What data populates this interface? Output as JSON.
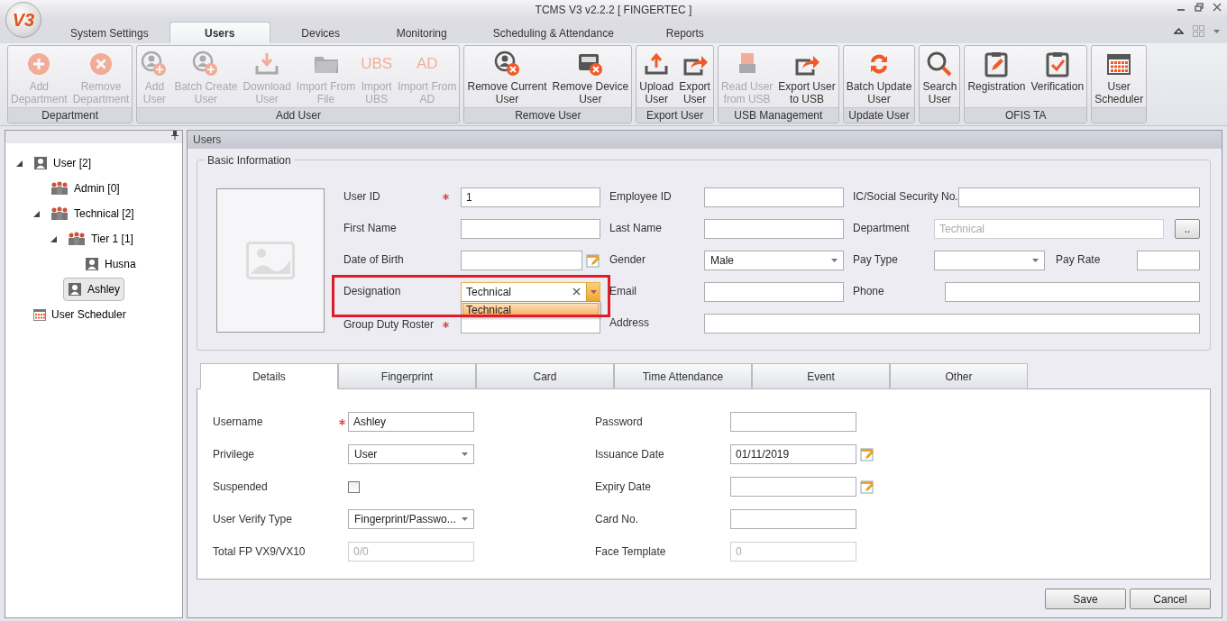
{
  "window": {
    "title": "TCMS V3 v2.2.2 [ FINGERTEC ]",
    "logo": "V3"
  },
  "menu_tabs": [
    {
      "label": "System Settings",
      "selected": false
    },
    {
      "label": "Users",
      "selected": true
    },
    {
      "label": "Devices",
      "selected": false
    },
    {
      "label": "Monitoring",
      "selected": false
    },
    {
      "label": "Scheduling & Attendance",
      "selected": false
    },
    {
      "label": "Reports",
      "selected": false
    }
  ],
  "ribbon": [
    {
      "name": "Department",
      "buttons": [
        {
          "label": "Add\nDepartment",
          "kind": "plus-circle",
          "disabled": true
        },
        {
          "label": "Remove\nDepartment",
          "kind": "x-circle",
          "disabled": true
        }
      ]
    },
    {
      "name": "Add User",
      "buttons": [
        {
          "label": "Add\nUser",
          "kind": "user-plus",
          "disabled": true
        },
        {
          "label": "Batch Create\nUser",
          "kind": "user-plus",
          "disabled": true
        },
        {
          "label": "Download\nUser",
          "kind": "download",
          "disabled": true
        },
        {
          "label": "Import From\nFile",
          "kind": "folder",
          "disabled": true
        },
        {
          "label": "Import\nUBS",
          "kind": "text",
          "icon_text": "UBS",
          "disabled": true
        },
        {
          "label": "Import From\nAD",
          "kind": "text",
          "icon_text": "AD",
          "disabled": true
        }
      ]
    },
    {
      "name": "Remove User",
      "buttons": [
        {
          "label": "Remove Current\nUser",
          "kind": "user-x",
          "disabled": false
        },
        {
          "label": "Remove Device\nUser",
          "kind": "device-x",
          "disabled": false
        }
      ]
    },
    {
      "name": "Export User",
      "buttons": [
        {
          "label": "Upload\nUser",
          "kind": "upload",
          "disabled": false
        },
        {
          "label": "Export\nUser",
          "kind": "export",
          "disabled": false
        }
      ]
    },
    {
      "name": "USB Management",
      "buttons": [
        {
          "label": "Read User\nfrom USB",
          "kind": "usb",
          "disabled": true
        },
        {
          "label": "Export User\nto USB",
          "kind": "export",
          "disabled": false
        }
      ]
    },
    {
      "name": "Update User",
      "buttons": [
        {
          "label": "Batch Update\nUser",
          "kind": "sync",
          "disabled": false
        }
      ]
    },
    {
      "buttons": [
        {
          "label": "Search\nUser",
          "kind": "search",
          "disabled": false
        }
      ]
    },
    {
      "name": "OFIS TA",
      "buttons": [
        {
          "label": "Registration",
          "kind": "clipboard-edit",
          "disabled": false
        },
        {
          "label": "Verification",
          "kind": "clipboard-check",
          "disabled": false
        }
      ]
    },
    {
      "buttons": [
        {
          "label": "User\nScheduler",
          "kind": "calendar",
          "disabled": false
        }
      ]
    }
  ],
  "tree": [
    {
      "label": "User [2]",
      "kind": "user",
      "selected": false,
      "expanded": true,
      "children": [
        {
          "label": "Admin [0]",
          "kind": "group",
          "selected": false
        },
        {
          "label": "Technical [2]",
          "kind": "group",
          "selected": false,
          "expanded": true,
          "children": [
            {
              "label": "Tier 1 [1]",
              "kind": "group",
              "selected": false,
              "expanded": true,
              "children": [
                {
                  "label": "Husna",
                  "kind": "user",
                  "selected": false
                }
              ]
            },
            {
              "label": "Ashley",
              "kind": "user",
              "selected": true
            }
          ]
        }
      ]
    },
    {
      "label": "User Scheduler",
      "kind": "scheduler",
      "selected": false
    }
  ],
  "panel_title": "Users",
  "basic_info": {
    "title": "Basic Information",
    "user_id": {
      "label": "User ID",
      "value": "1",
      "required": true
    },
    "employee_id": {
      "label": "Employee ID"
    },
    "ic_no": {
      "label": "IC/Social Security No."
    },
    "first_name": {
      "label": "First Name"
    },
    "last_name": {
      "label": "Last Name"
    },
    "department": {
      "label": "Department",
      "value": "Technical",
      "disabled": true,
      "browse": ".."
    },
    "date_of_birth": {
      "label": "Date of Birth"
    },
    "gender": {
      "label": "Gender",
      "value": "Male"
    },
    "pay_type": {
      "label": "Pay Type"
    },
    "pay_rate": {
      "label": "Pay Rate"
    },
    "designation": {
      "label": "Designation",
      "value": "Technical",
      "open": true,
      "options": [
        {
          "label": "Technical",
          "selected": true
        }
      ]
    },
    "email": {
      "label": "Email"
    },
    "phone": {
      "label": "Phone"
    },
    "group_duty_roster": {
      "label": "Group Duty Roster",
      "required": true
    },
    "address": {
      "label": "Address"
    }
  },
  "detail_tabs": [
    {
      "label": "Details",
      "selected": true
    },
    {
      "label": "Fingerprint",
      "selected": false
    },
    {
      "label": "Card",
      "selected": false
    },
    {
      "label": "Time Attendance",
      "selected": false
    },
    {
      "label": "Event",
      "selected": false
    },
    {
      "label": "Other",
      "selected": false
    }
  ],
  "details": {
    "left": [
      {
        "label": "Username",
        "kind": "text",
        "value": "Ashley",
        "required": true
      },
      {
        "label": "Privilege",
        "kind": "select",
        "value": "User"
      },
      {
        "label": "Suspended",
        "kind": "checkbox",
        "checked": false
      },
      {
        "label": "User Verify Type",
        "kind": "select",
        "value": "Fingerprint/Passwo..."
      },
      {
        "label": "Total FP VX9/VX10",
        "kind": "text",
        "value": "0/0",
        "disabled": true
      }
    ],
    "right": [
      {
        "label": "Password",
        "kind": "text"
      },
      {
        "label": "Issuance Date",
        "kind": "date",
        "value": "01/11/2019"
      },
      {
        "label": "Expiry Date",
        "kind": "date"
      },
      {
        "label": "Card No.",
        "kind": "text"
      },
      {
        "label": "Face Template",
        "kind": "text",
        "value": "0",
        "disabled": true
      }
    ]
  },
  "buttons": [
    {
      "label": "Save"
    },
    {
      "label": "Cancel"
    }
  ]
}
